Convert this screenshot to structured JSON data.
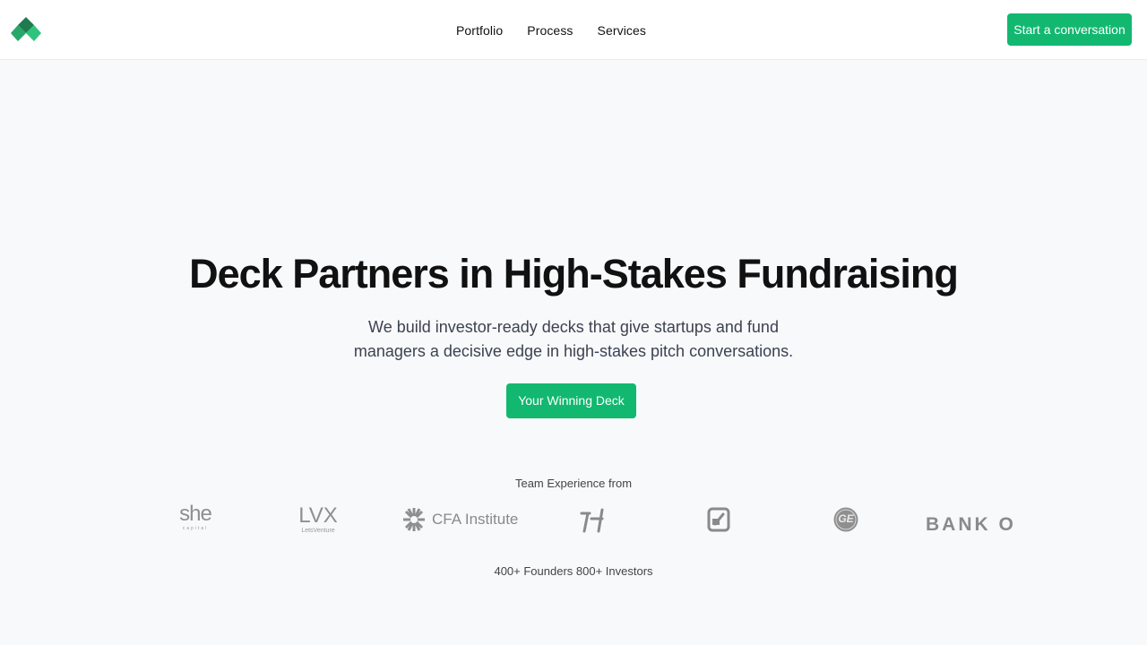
{
  "header": {
    "logo_icon": "green-diamond-logo",
    "nav": [
      {
        "label": "Portfolio"
      },
      {
        "label": "Process"
      },
      {
        "label": "Services"
      }
    ],
    "cta_label": "Start a conversation"
  },
  "hero": {
    "title": "Deck Partners in High-Stakes Fundraising",
    "subtitle": "We build investor-ready decks that give startups and fund managers a decisive edge in high-stakes pitch conversations.",
    "cta_label": "Your Winning Deck"
  },
  "team": {
    "label": "Team Experience from",
    "logos": [
      {
        "name": "she",
        "sub": "capital"
      },
      {
        "name": "LVX",
        "sub": "LetsVenture"
      },
      {
        "name": "CFA Institute"
      },
      {
        "name": "bracket-logo"
      },
      {
        "name": "square-logo"
      },
      {
        "name": "GE"
      },
      {
        "name": "BANK O"
      }
    ]
  },
  "stats": "400+ Founders 800+ Investors",
  "colors": {
    "accent": "#12b870",
    "background": "#f8f9fb",
    "logo_gray": "#8a8a8a"
  }
}
